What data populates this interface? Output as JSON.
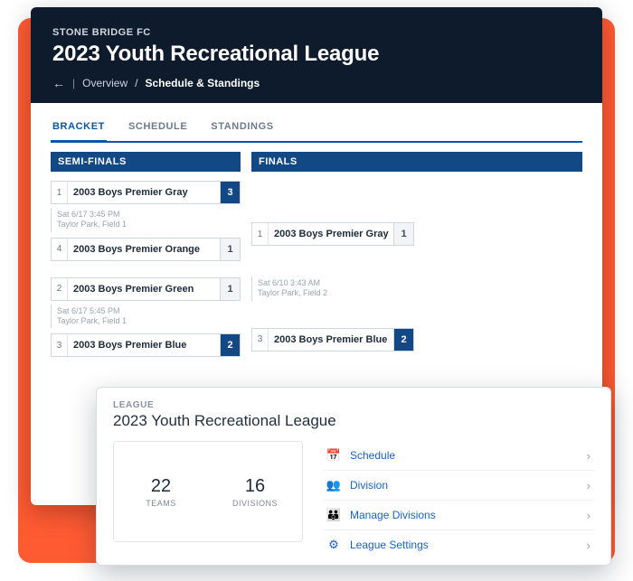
{
  "header": {
    "org": "STONE BRIDGE FC",
    "title": "2023 Youth Recreational League",
    "breadcrumb": {
      "back_glyph": "←",
      "overview": "Overview",
      "current": "Schedule & Standings"
    }
  },
  "tabs": {
    "bracket": "BRACKET",
    "schedule": "SCHEDULE",
    "standings": "STANDINGS"
  },
  "rounds": {
    "semi": "SEMI-FINALS",
    "finals": "FINALS"
  },
  "semi1": {
    "t1": {
      "seed": "1",
      "name": "2003 Boys Premier Gray",
      "score": "3"
    },
    "t2": {
      "seed": "4",
      "name": "2003 Boys Premier Orange",
      "score": "1"
    },
    "time": "Sat 6/17 3:45 PM",
    "loc": "Taylor Park, Field 1"
  },
  "semi2": {
    "t1": {
      "seed": "2",
      "name": "2003 Boys Premier Green",
      "score": "1"
    },
    "t2": {
      "seed": "3",
      "name": "2003 Boys Premier Blue",
      "score": "2"
    },
    "time": "Sat 6/17 5:45 PM",
    "loc": "Taylor Park, Field 1"
  },
  "final": {
    "t1": {
      "seed": "1",
      "name": "2003 Boys Premier Gray",
      "score": "1"
    },
    "t2": {
      "seed": "3",
      "name": "2003 Boys Premier Blue",
      "score": "2"
    },
    "time": "Sat 6/10 3:43 AM",
    "loc": "Taylor Park, Field 2"
  },
  "winner": "2003 Boys Premier Blue",
  "league_card": {
    "label": "LEAGUE",
    "title": "2023 Youth Recreational League",
    "stats": {
      "teams_n": "22",
      "teams_l": "TEAMS",
      "div_n": "16",
      "div_l": "DIVISIONS"
    },
    "links": {
      "schedule": "Schedule",
      "division": "Division",
      "manage": "Manage Divisions",
      "settings": "League Settings"
    },
    "chev": "›"
  },
  "icons": {
    "calendar": "📅",
    "division": "👥",
    "manage": "👪",
    "gear": "⚙"
  }
}
